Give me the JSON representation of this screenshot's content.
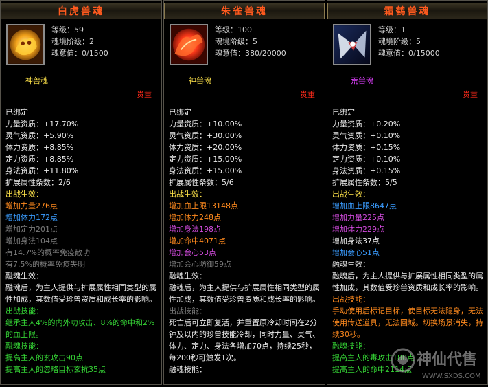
{
  "panels": [
    {
      "title": "白虎兽魂",
      "level": "等级：59",
      "tier": "魂境阶级：2",
      "soul": "魂意值：0/1500",
      "kind": "神兽魂",
      "rarity": "贵重",
      "lines": [
        {
          "t": "已绑定",
          "c": "w"
        },
        {
          "t": "力量资质：+17.70%",
          "c": "w"
        },
        {
          "t": "灵气资质：+5.90%",
          "c": "w"
        },
        {
          "t": "体力资质：+8.85%",
          "c": "w"
        },
        {
          "t": "定力资质：+8.85%",
          "c": "w"
        },
        {
          "t": "身法资质：+11.80%",
          "c": "w"
        },
        {
          "t": "扩展属性条数：2/6",
          "c": "w"
        },
        {
          "t": "出战生效：",
          "c": "y"
        },
        {
          "t": "增加力量276点",
          "c": "o"
        },
        {
          "t": "增加体力172点",
          "c": "b"
        },
        {
          "t": "增加定力201点",
          "c": "gr"
        },
        {
          "t": "增加身法104点",
          "c": "gr"
        },
        {
          "t": "有14.7%的概率免疫散功",
          "c": "gr"
        },
        {
          "t": "有7.5%的概率免疫失明",
          "c": "gr"
        },
        {
          "t": "融魂生效：",
          "c": "w"
        },
        {
          "t": "融魂后，为主人提供与扩展属性相同类型的属性加成，其数值受珍兽资质和成长率的影响。",
          "c": "w",
          "wrap": true
        },
        {
          "t": "出战技能：",
          "c": "g"
        },
        {
          "t": "继承主人4%的内外功攻击、8%的命中和2%的血上限。",
          "c": "g",
          "wrap": true
        },
        {
          "t": "融魂技能：",
          "c": "g"
        },
        {
          "t": "提高主人的玄攻击90点",
          "c": "g"
        },
        {
          "t": "提高主人的忽略目标玄抗35点",
          "c": "g"
        }
      ]
    },
    {
      "title": "朱雀兽魂",
      "level": "等级：100",
      "tier": "魂境阶级：5",
      "soul": "魂意值：380/20000",
      "kind": "神兽魂",
      "rarity": "贵重",
      "lines": [
        {
          "t": "已绑定",
          "c": "w"
        },
        {
          "t": "力量资质：+10.00%",
          "c": "w"
        },
        {
          "t": "灵气资质：+30.00%",
          "c": "w"
        },
        {
          "t": "体力资质：+20.00%",
          "c": "w"
        },
        {
          "t": "定力资质：+15.00%",
          "c": "w"
        },
        {
          "t": "身法资质：+15.00%",
          "c": "w"
        },
        {
          "t": "扩展属性条数：5/6",
          "c": "w"
        },
        {
          "t": "出战生效：",
          "c": "y"
        },
        {
          "t": "增加血上限13148点",
          "c": "o"
        },
        {
          "t": "增加体力248点",
          "c": "o"
        },
        {
          "t": "增加身法198点",
          "c": "p"
        },
        {
          "t": "增加命中4071点",
          "c": "o"
        },
        {
          "t": "增加会心53点",
          "c": "p"
        },
        {
          "t": "增加会心防御59点",
          "c": "gr"
        },
        {
          "t": "融魂生效：",
          "c": "w"
        },
        {
          "t": "融魂后，为主人提供与扩展属性相同类型的属性加成，其数值受珍兽资质和成长率的影响。",
          "c": "w",
          "wrap": true
        },
        {
          "t": "出战技能：",
          "c": "gr"
        },
        {
          "t": "死亡后可立即复活，并重置原冷却时间在2分钟及以内的珍兽技能冷却，同时力量、灵气、体力、定力、身法各增加70点，持续25秒，每200秒可触发1次。",
          "c": "w",
          "wrap": true
        },
        {
          "t": "融魂技能：",
          "c": "w"
        }
      ]
    },
    {
      "title": "霜鹤兽魂",
      "level": "等级：1",
      "tier": "魂境阶级：5",
      "soul": "魂意值：0/15000",
      "kind": "荒兽魂",
      "rarity": "贵重",
      "lines": [
        {
          "t": "已绑定",
          "c": "w"
        },
        {
          "t": "力量资质：+0.20%",
          "c": "w"
        },
        {
          "t": "灵气资质：+0.10%",
          "c": "w"
        },
        {
          "t": "体力资质：+0.15%",
          "c": "w"
        },
        {
          "t": "定力资质：+0.10%",
          "c": "w"
        },
        {
          "t": "身法资质：+0.15%",
          "c": "w"
        },
        {
          "t": "扩展属性条数：5/5",
          "c": "w"
        },
        {
          "t": "出战生效：",
          "c": "y"
        },
        {
          "t": "增加血上限8647点",
          "c": "b"
        },
        {
          "t": "增加力量225点",
          "c": "p"
        },
        {
          "t": "增加体力229点",
          "c": "p"
        },
        {
          "t": "增加身法37点",
          "c": "w"
        },
        {
          "t": "增加会心51点",
          "c": "b"
        },
        {
          "t": "融魂生效：",
          "c": "w"
        },
        {
          "t": "融魂后，为主人提供与扩展属性相同类型的属性加成，其数值受珍兽资质和成长率的影响。",
          "c": "w",
          "wrap": true
        },
        {
          "t": "出战技能：",
          "c": "o"
        },
        {
          "t": "手动使用后标记目标，使目标无法隐身，无法使用传送道具，无法回城。切换场景消失，持续30秒。",
          "c": "o",
          "wrap": true
        },
        {
          "t": "融魂技能：",
          "c": "g"
        },
        {
          "t": "提高主人的毒攻击180点",
          "c": "g"
        },
        {
          "t": "提高主人的命中2114点",
          "c": "g"
        }
      ]
    }
  ],
  "watermark": {
    "text": "神仙代售",
    "site": "WWW.SXDS.COM"
  },
  "colors": {
    "title": "#ff5a1e",
    "rarity": "#ff2a1a",
    "kind_holy": "#ffe34a",
    "kind_wild": "#e040ff"
  },
  "icons": [
    "white-tiger-icon",
    "vermilion-bird-icon",
    "frost-crane-icon"
  ]
}
